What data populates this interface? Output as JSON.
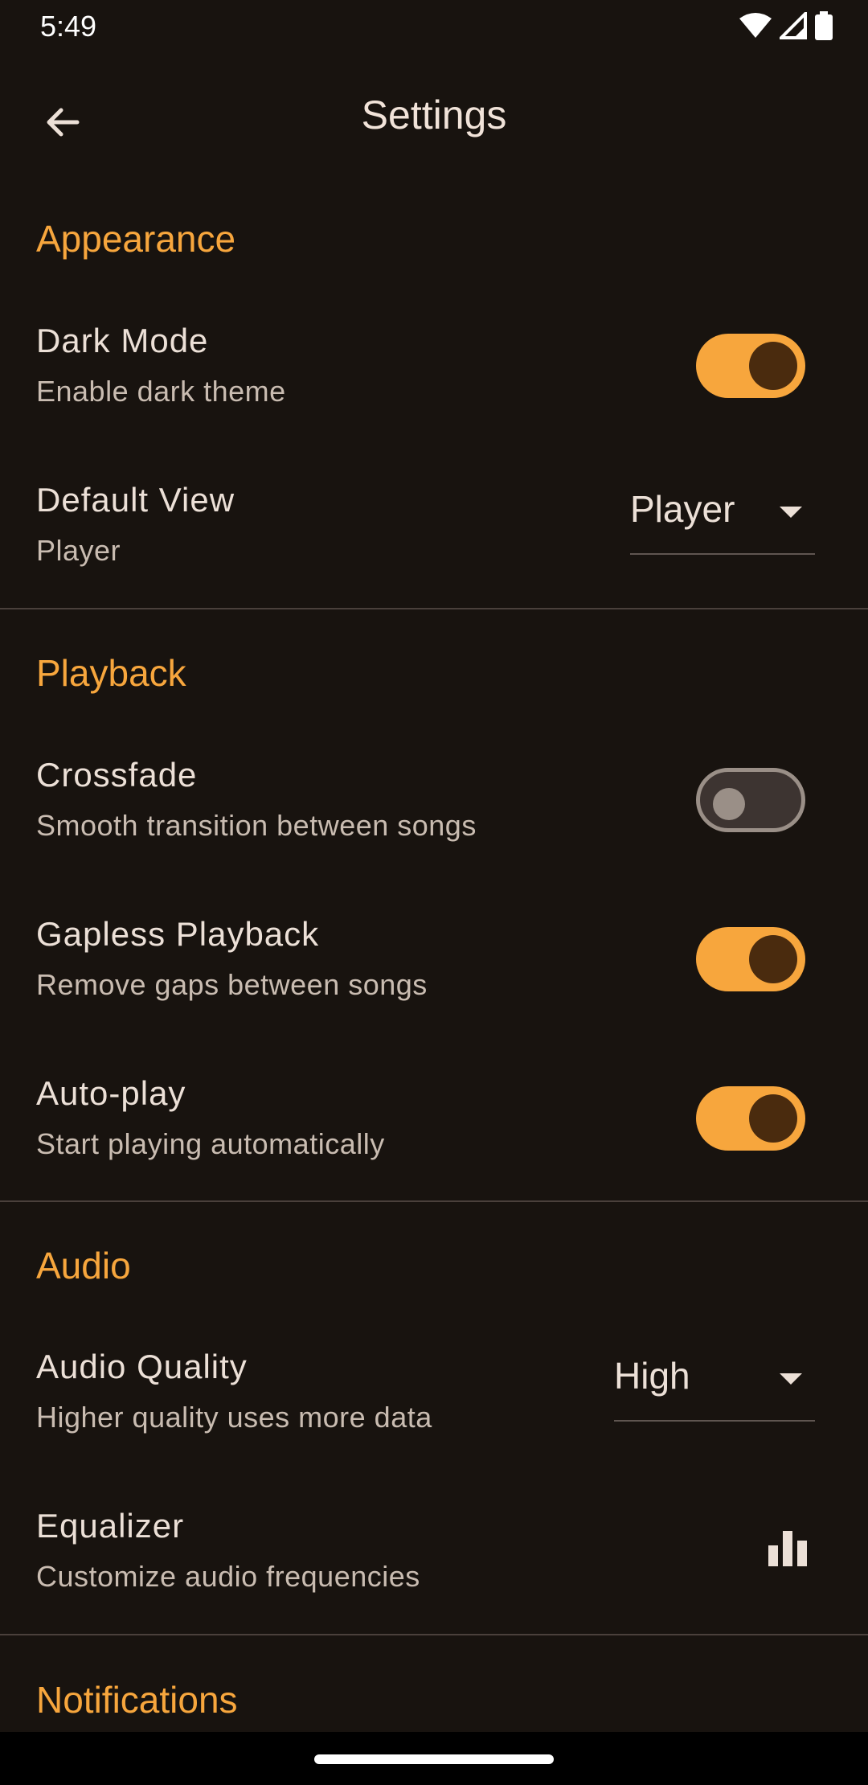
{
  "status_bar": {
    "time": "5:49"
  },
  "header": {
    "title": "Settings"
  },
  "sections": {
    "appearance": {
      "title": "Appearance"
    },
    "playback": {
      "title": "Playback"
    },
    "audio": {
      "title": "Audio"
    },
    "notifications": {
      "title": "Notifications"
    }
  },
  "items": {
    "dark_mode": {
      "title": "Dark Mode",
      "subtitle": "Enable dark theme",
      "enabled": true
    },
    "default_view": {
      "title": "Default View",
      "subtitle": "Player",
      "value": "Player"
    },
    "crossfade": {
      "title": "Crossfade",
      "subtitle": "Smooth transition between songs",
      "enabled": false
    },
    "gapless": {
      "title": "Gapless Playback",
      "subtitle": "Remove gaps between songs",
      "enabled": true
    },
    "autoplay": {
      "title": "Auto-play",
      "subtitle": "Start playing automatically",
      "enabled": true
    },
    "audio_quality": {
      "title": "Audio Quality",
      "subtitle": "Higher quality uses more data",
      "value": "High"
    },
    "equalizer": {
      "title": "Equalizer",
      "subtitle": "Customize audio frequencies",
      "icon": "equalizer-icon"
    }
  },
  "colors": {
    "background": "#18130f",
    "accent": "#f7a63d",
    "text": "#ece0d7",
    "subtext": "#c9bcb1"
  }
}
